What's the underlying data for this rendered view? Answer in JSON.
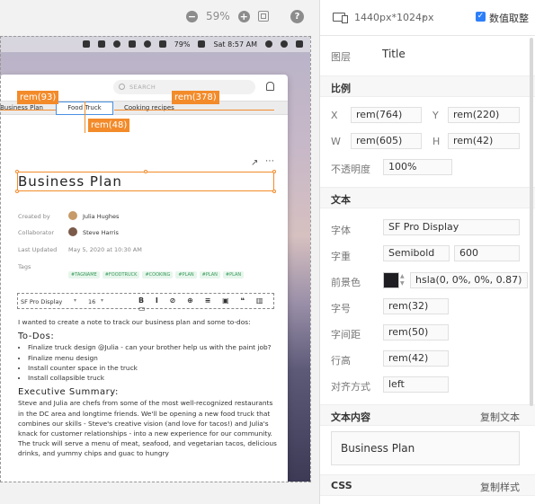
{
  "zoom": {
    "value": "59%"
  },
  "menubar": {
    "battery": "79%",
    "time": "Sat 8:57 AM"
  },
  "app": {
    "search_placeholder": "SEARCH",
    "tabs": [
      "Business Plan",
      "Food Truck",
      "Cooking recipes"
    ],
    "title": "Business Plan",
    "meta": {
      "created_by_label": "Created by",
      "created_by": "Julia Hughes",
      "collaborator_label": "Collaborator",
      "collaborator": "Steve Harris",
      "last_updated_label": "Last Updated",
      "last_updated": "May 5, 2020 at 10:30 AM",
      "tags_label": "Tags",
      "tags": [
        "#TAGNAME",
        "#FOODTRUCK",
        "#COOKING",
        "#PLAN",
        "#PLAN",
        "#PLAN"
      ]
    },
    "toolbar": {
      "font": "SF Pro Display",
      "size": "16"
    },
    "body": {
      "intro": "I wanted to create a note to track our business plan and some to-dos:",
      "todo_heading": "To-Dos:",
      "todos": [
        "Finalize truck design @Julia - can your brother help us with the paint job?",
        "Finalize menu design",
        "Install counter space in the truck",
        "Install collapsible truck"
      ],
      "summary_heading": "Executive Summary:",
      "summary": "Steve and Julia are chefs from some of the most well-recognized restaurants in the DC area and longtime friends. We'll be opening a new food truck that combines our skills - Steve's creative vision (and love for tacos!) and Julia's knack for customer relationships - into a new experience for our community. The truck will serve a menu of meat, seafood, and vegetarian tacos, delicious drinks, and yummy chips and guac to hungry"
    }
  },
  "measurements": {
    "left": "rem(93)",
    "right": "rem(378)",
    "top": "rem(48)"
  },
  "panel": {
    "device_size": "1440px*1024px",
    "keep_value_label": "数值取整",
    "layer_label": "图层",
    "layer_value": "Title",
    "position_section": "比例",
    "x_label": "X",
    "x_value": "rem(764)",
    "y_label": "Y",
    "y_value": "rem(220)",
    "w_label": "W",
    "w_value": "rem(605)",
    "h_label": "H",
    "h_value": "rem(42)",
    "opacity_label": "不透明度",
    "opacity_value": "100%",
    "text_section": "文本",
    "font_label": "字体",
    "font_value": "SF Pro Display",
    "weight_label": "字重",
    "weight_name": "Semibold",
    "weight_value": "600",
    "color_label": "前景色",
    "color_value": "hsla(0, 0%, 0%, 0.87)",
    "size_label": "字号",
    "size_value": "rem(32)",
    "letter_label": "字间距",
    "letter_value": "rem(50)",
    "line_label": "行高",
    "line_value": "rem(42)",
    "align_label": "对齐方式",
    "align_value": "left",
    "content_section": "文本内容",
    "copy_text": "复制文本",
    "content_value": "Business Plan",
    "css_section": "CSS",
    "copy_style": "复制样式"
  }
}
